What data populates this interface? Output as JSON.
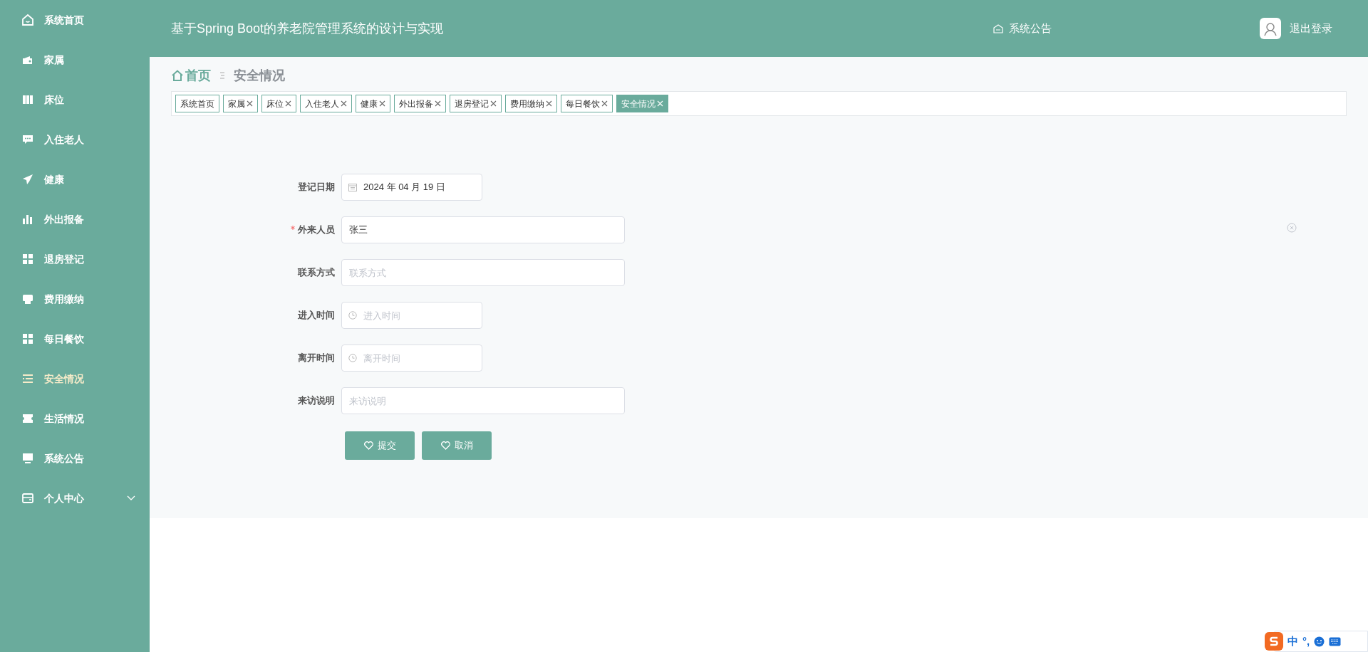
{
  "sidebar": {
    "items": [
      {
        "label": "系统首页",
        "selected": false
      },
      {
        "label": "家属",
        "selected": false
      },
      {
        "label": "床位",
        "selected": false
      },
      {
        "label": "入住老人",
        "selected": false
      },
      {
        "label": "健康",
        "selected": false
      },
      {
        "label": "外出报备",
        "selected": false
      },
      {
        "label": "退房登记",
        "selected": false
      },
      {
        "label": "费用缴纳",
        "selected": false
      },
      {
        "label": "每日餐饮",
        "selected": false
      },
      {
        "label": "安全情况",
        "selected": true
      },
      {
        "label": "生活情况",
        "selected": false
      },
      {
        "label": "系统公告",
        "selected": false
      },
      {
        "label": "个人中心",
        "selected": false,
        "expanded": false
      }
    ]
  },
  "header": {
    "title": "基于Spring Boot的养老院管理系统的设计与实现",
    "notice": "系统公告",
    "logout": "退出登录"
  },
  "breadcrumb": [
    "首页",
    "安全情况"
  ],
  "tabs": [
    {
      "label": "系统首页",
      "closable": false,
      "selected": false
    },
    {
      "label": "家属",
      "closable": true,
      "selected": false
    },
    {
      "label": "床位",
      "closable": true,
      "selected": false
    },
    {
      "label": "入住老人",
      "closable": true,
      "selected": false
    },
    {
      "label": "健康",
      "closable": true,
      "selected": false
    },
    {
      "label": "外出报备",
      "closable": true,
      "selected": false
    },
    {
      "label": "退房登记",
      "closable": true,
      "selected": false
    },
    {
      "label": "费用缴纳",
      "closable": true,
      "selected": false
    },
    {
      "label": "每日餐饮",
      "closable": true,
      "selected": false
    },
    {
      "label": "安全情况",
      "closable": true,
      "selected": true
    }
  ],
  "form": {
    "fields": [
      {
        "label": "登记日期",
        "kind": "date",
        "value": "2024 年 04 月 19 日",
        "required": false,
        "wide": false
      },
      {
        "label": "外来人员",
        "kind": "text",
        "value": "张三",
        "required": true,
        "wide": true
      },
      {
        "label": "联系方式",
        "kind": "text",
        "placeholder": "联系方式",
        "required": false,
        "wide": true
      },
      {
        "label": "进入时间",
        "kind": "time",
        "placeholder": "进入时间",
        "required": false,
        "wide": false
      },
      {
        "label": "离开时间",
        "kind": "time",
        "placeholder": "离开时间",
        "required": false,
        "wide": false
      },
      {
        "label": "来访说明",
        "kind": "text",
        "placeholder": "来访说明",
        "required": false,
        "wide": true
      }
    ],
    "buttons": [
      "提交",
      "取消"
    ]
  },
  "ime_toolbar": {
    "mode": "中",
    "punctuation": "°,"
  }
}
